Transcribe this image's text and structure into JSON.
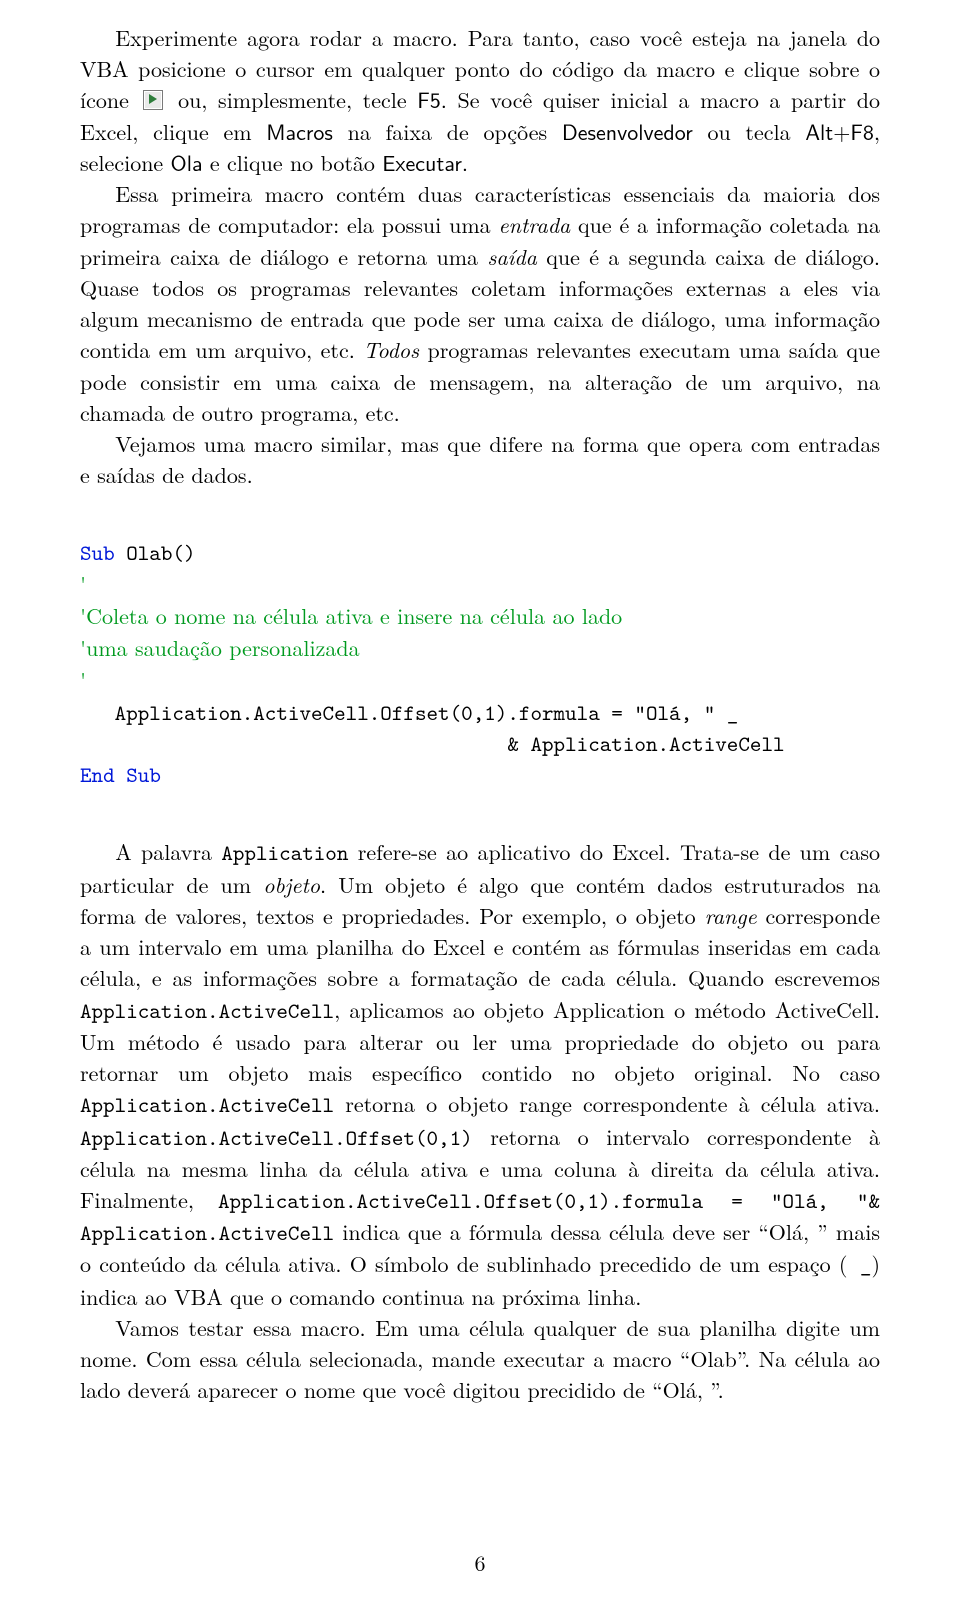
{
  "para1": {
    "a": "Experimente agora rodar a macro. Para tanto, caso você esteja na janela do VBA posicione o cursor em qualquer ponto do código da macro e clique sobre o ícone ",
    "b": " ou, simplesmente, tecle ",
    "f5": "F5",
    "c": ". Se você quiser inicial a macro a partir do Excel, clique em ",
    "macros": "Macros",
    "d": " na faixa de opções ",
    "desenv": "Desenvolvedor",
    "e": " ou tecla ",
    "altf8": "Alt+F8",
    "f": ", selecione ",
    "ola": "Ola",
    "g": " e clique no botão ",
    "exec": "Executar",
    "h": "."
  },
  "para2": {
    "a": "Essa primeira macro contém duas características essenciais da maioria dos programas de computador: ela possui uma ",
    "entrada": "entrada",
    "b": " que é a informação coletada na primeira caixa de diálogo e retorna uma ",
    "saida": "saída",
    "c": " que é a segunda caixa de diálogo. Quase todos os programas relevantes coletam informações externas a eles via algum mecanismo de entrada que pode ser uma caixa de diálogo, uma informação contida em um arquivo, etc. ",
    "todos": "Todos",
    "d": " programas relevantes executam uma saída que pode consistir em uma caixa de mensagem, na alteração de um arquivo, na chamada de outro programa, etc."
  },
  "para3": "Vejamos uma macro similar, mas que difere na forma que opera com entradas e saídas de dados.",
  "code": {
    "l1a": "Sub",
    "l1b": " Olab()",
    "l2": "'",
    "l3": "'Coleta o nome na célula ativa e insere na célula ao lado",
    "l4": "'uma saudação personalizada",
    "l5": "'",
    "l6": "   Application.ActiveCell.Offset(0,1).formula = \"Olá, \" _",
    "l7": "                                     & Application.ActiveCell",
    "l8a": "End",
    "l8b": " ",
    "l8c": "Sub"
  },
  "para4": {
    "a": "A palavra ",
    "app": "Application",
    "b": " refere-se ao aplicativo do Excel. Trata-se de um caso particular de um ",
    "objeto": "objeto",
    "c": ". Um objeto é algo que contém dados estruturados na forma de valores, textos e propriedades. Por exemplo, o objeto ",
    "range": "range",
    "d": " corresponde a um intervalo em uma planilha do Excel e contém as fórmulas inseridas em cada célula, e as informações sobre a formatação de cada célula. Quando escrevemos ",
    "appac": "Application.ActiveCell",
    "e": ", aplicamos ao objeto Application o método ActiveCell. Um método é usado para alterar ou ler uma propriedade do objeto ou para retornar um objeto mais específico contido no objeto original. No caso ",
    "appac2": "Application.ActiveCell",
    "f": " retorna o objeto range correspondente à célula ativa. ",
    "appoff": "Application.ActiveCell.Offset(0,1)",
    "g": " retorna o intervalo correspondente à célula na mesma linha da célula ativa e uma coluna à direita da célula ativa. Finalmente, ",
    "appform": "Application.ActiveCell.Offset(0,1).formula = \"Olá, \"& Application.ActiveCell",
    "h": " indica que a fórmula dessa célula deve ser “Olá, ” mais o conteúdo da célula ativa. O símbolo de sublinhado precedido de um espaço (",
    "underscore": " _",
    "i": ") indica ao VBA que o comando continua na próxima linha."
  },
  "para5": "Vamos testar essa macro. Em uma célula qualquer de sua planilha digite um nome. Com essa célula selecionada, mande executar a macro “Olab”. Na célula ao lado deverá aparecer o nome que você digitou precidido de “Olá, ”.",
  "pagenum": "6"
}
